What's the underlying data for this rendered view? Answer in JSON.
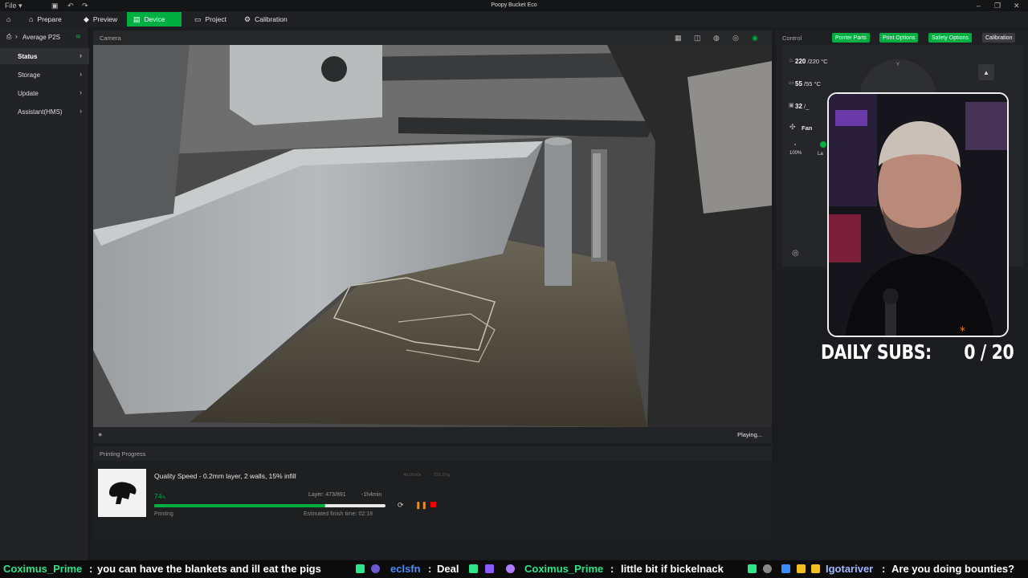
{
  "titlebar": {
    "file_menu": "File",
    "title": "Poopy Bucket Eco"
  },
  "nav": {
    "prepare": "Prepare",
    "preview": "Preview",
    "device": "Device",
    "project": "Project",
    "calibration": "Calibration"
  },
  "sidebar": {
    "printer_name": "Average P2S",
    "items": [
      {
        "label": "Status"
      },
      {
        "label": "Storage"
      },
      {
        "label": "Update"
      },
      {
        "label": "Assistant(HMS)"
      }
    ]
  },
  "camera": {
    "header": "Camera",
    "status": "Playing..."
  },
  "progress": {
    "header": "Printing Progress",
    "job_title": "Quality Speed - 0.2mm layer, 2 walls, 15% infill",
    "meta1": "4h18m0s",
    "meta2": "232.57g",
    "percent": "74",
    "percent_unit": "%",
    "percent_fraction": 0.74,
    "layer": "Layer: 473/891",
    "remaining": "-1h4min",
    "state": "Printing",
    "eta": "Estimated finish time: 02:18"
  },
  "control": {
    "header": "Control",
    "buttons": {
      "printer_parts": "Printer Parts",
      "print_options": "Print Options",
      "safety_options": "Safety Options",
      "calibration": "Calibration"
    },
    "nozzle": {
      "value": "220",
      "target": "/220",
      "unit": "°C"
    },
    "bed": {
      "value": "55",
      "target": "/55",
      "unit": "°C"
    },
    "chamber": {
      "value": "32",
      "target": "/_"
    },
    "fan_label": "Fan",
    "speed": "100%",
    "lamp_partial": "La",
    "axis_label": "Y"
  },
  "overlay": {
    "daily_subs_label": "DAILY SUBS:",
    "daily_subs_value": "0 / 20"
  },
  "ticker": [
    {
      "user": "Coximus_Prime",
      "sep": ":",
      "msg": "you can have the blankets and ill eat the pigs",
      "color": "#2fe58a"
    },
    {
      "user": "eclsfn",
      "sep": ":",
      "msg": "Deal",
      "color": "#4b8cff"
    },
    {
      "user": "Coximus_Prime",
      "sep": ":",
      "msg": "little bit if bickelnack",
      "color": "#2fe58a"
    },
    {
      "user": "Igotariver",
      "sep": ":",
      "msg": "Are you doing bounties?",
      "color": "#9fb7ff"
    }
  ]
}
